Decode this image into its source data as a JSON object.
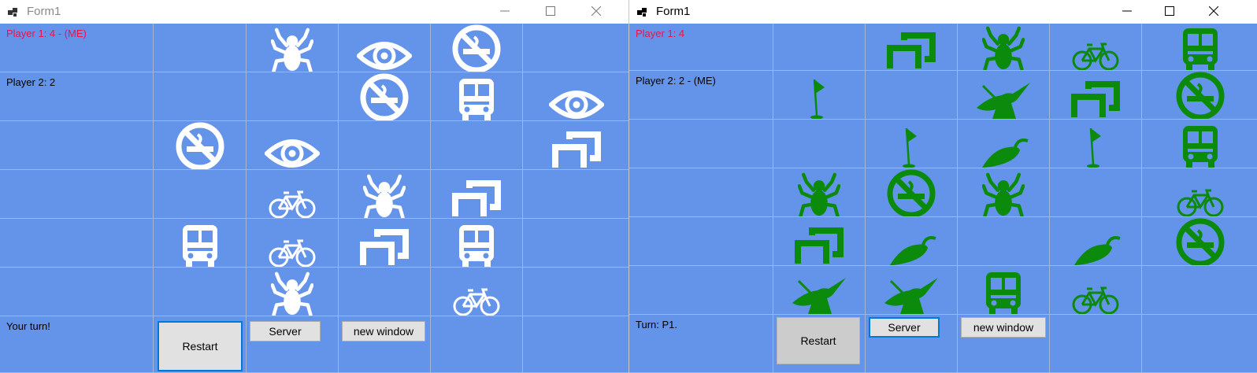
{
  "colors": {
    "board": "#6494ea",
    "player_me_text": "#e8154b",
    "label_text": "#000000",
    "icon_white": "#ffffff",
    "icon_green": "#0b8a0b"
  },
  "windows": [
    {
      "title": "Form1",
      "active": false,
      "icon_color": "white",
      "labels": {
        "player1": "Player 1: 4 - (ME)",
        "player2": "Player 2: 2",
        "turn": "Your turn!"
      },
      "buttons": {
        "restart": "Restart",
        "server": "Server",
        "new_window": "new window"
      },
      "tiles": [
        [
          "",
          "spider-icon",
          "eye-icon",
          "no-smoking-icon",
          ""
        ],
        [
          "",
          "",
          "no-smoking-icon",
          "bus-icon",
          "eye-icon"
        ],
        [
          "no-smoking-icon",
          "eye-icon",
          "",
          "",
          "squares-icon"
        ],
        [
          "",
          "bicycle-icon",
          "spider-icon",
          "squares-icon",
          ""
        ],
        [
          "bus-icon",
          "bicycle-icon",
          "squares-icon",
          "bus-icon",
          ""
        ],
        [
          "",
          "spider-icon",
          "",
          "bicycle-icon",
          ""
        ]
      ]
    },
    {
      "title": "Form1",
      "active": true,
      "icon_color": "green",
      "labels": {
        "player1": "Player 1: 4",
        "player2": "Player 2: 2 - (ME)",
        "turn": "Turn: P1."
      },
      "buttons": {
        "restart": "Restart",
        "server": "Server",
        "new_window": "new window"
      },
      "tiles": [
        [
          "",
          "squares-icon",
          "spider-icon",
          "bicycle-icon",
          "bus-icon"
        ],
        [
          "flag-icon",
          "",
          "yoda-icon",
          "squares-icon",
          "no-smoking-icon"
        ],
        [
          "",
          "flag-icon",
          "pepper-icon",
          "flag-icon",
          "bus-icon"
        ],
        [
          "spider-icon",
          "no-smoking-icon",
          "spider-icon",
          "",
          "bicycle-icon"
        ],
        [
          "squares-icon",
          "pepper-icon",
          "",
          "pepper-icon",
          "no-smoking-icon"
        ],
        [
          "yoda-icon",
          "yoda-icon",
          "bus-icon",
          "bicycle-icon",
          ""
        ]
      ]
    }
  ]
}
